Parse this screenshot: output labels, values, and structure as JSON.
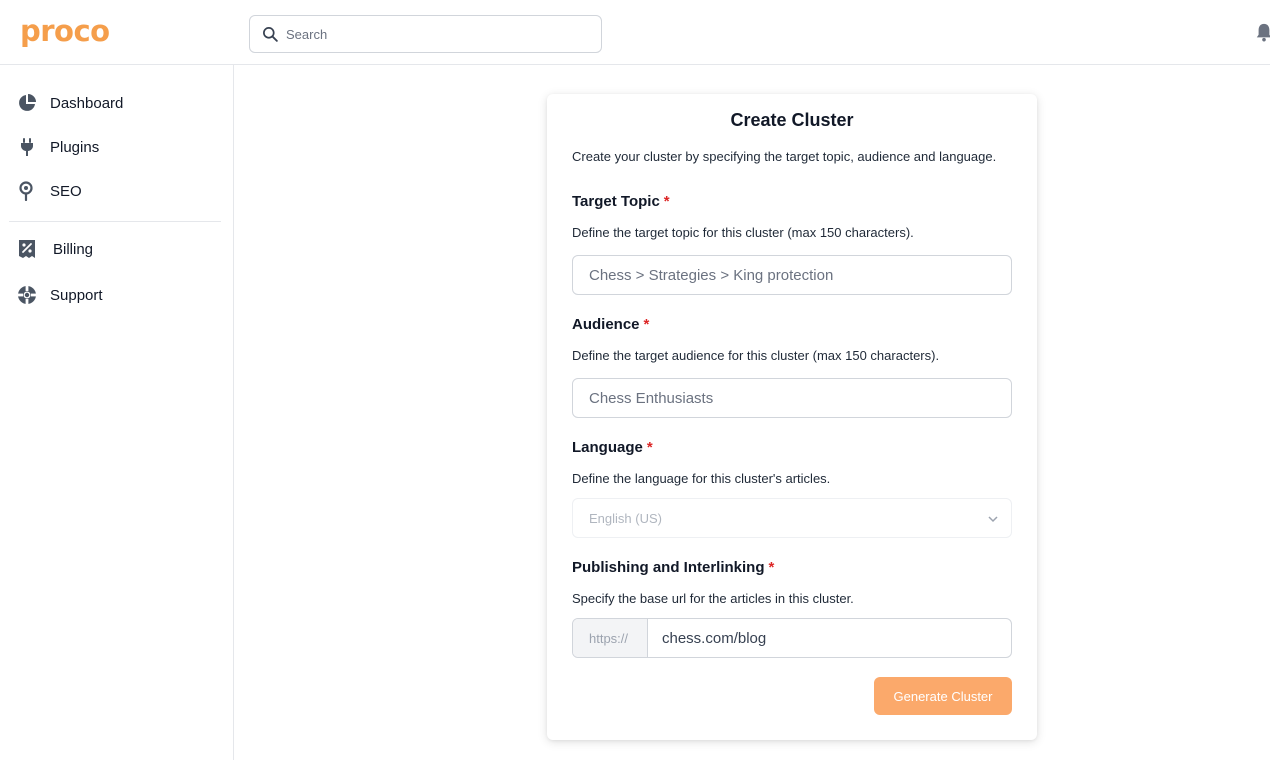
{
  "brand": {
    "logo": "proco",
    "accent": "#f59e4b"
  },
  "header": {
    "search_placeholder": "Search"
  },
  "sidebar": {
    "items": [
      {
        "label": "Dashboard",
        "icon": "pie-chart-icon"
      },
      {
        "label": "Plugins",
        "icon": "plug-icon"
      },
      {
        "label": "SEO",
        "icon": "map-pin-icon"
      },
      {
        "label": "Billing",
        "icon": "receipt-percent-icon"
      },
      {
        "label": "Support",
        "icon": "lifebuoy-icon"
      }
    ]
  },
  "form": {
    "title": "Create Cluster",
    "description": "Create your cluster by specifying the target topic, audience and language.",
    "required_mark": "*",
    "topic": {
      "label": "Target Topic",
      "help": "Define the target topic for this cluster (max 150 characters).",
      "placeholder": "Chess > Strategies > King protection"
    },
    "audience": {
      "label": "Audience",
      "help": "Define the target audience for this cluster (max 150 characters).",
      "placeholder": "Chess Enthusiasts"
    },
    "language": {
      "label": "Language",
      "help": "Define the language for this cluster's articles.",
      "selected": "English (US)"
    },
    "publishing": {
      "label": "Publishing and Interlinking",
      "help": "Specify the base url for the articles in this cluster.",
      "prefix": "https://",
      "value": "chess.com/blog"
    },
    "submit_label": "Generate Cluster"
  }
}
